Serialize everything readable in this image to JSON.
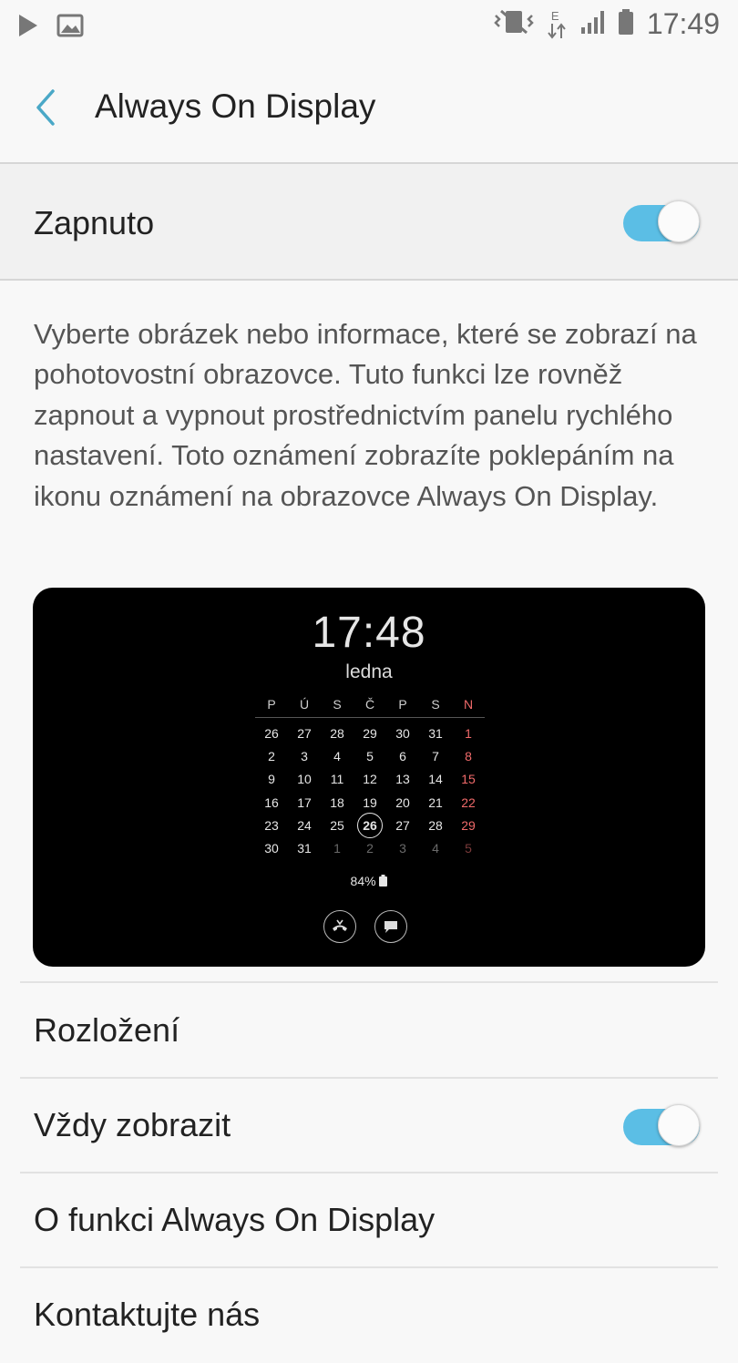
{
  "status_bar": {
    "time": "17:49",
    "network_type": "E",
    "icons": [
      "play-icon",
      "image-icon",
      "mute-vibrate-icon",
      "data-arrows-icon",
      "signal-icon",
      "battery-icon"
    ]
  },
  "header": {
    "title": "Always On Display"
  },
  "master": {
    "label": "Zapnuto",
    "enabled": true
  },
  "description": "Vyberte obrázek nebo informace, které se zobrazí na pohotovostní obrazovce. Tuto funkci lze rovněž zapnout a vypnout prostřednictvím panelu rychlého nastavení. Toto oznámení zobrazíte poklepáním na ikonu oznámení na obrazovce Always On Display.",
  "preview": {
    "time": "17:48",
    "month": "ledna",
    "weekdays": [
      "P",
      "Ú",
      "S",
      "Č",
      "P",
      "S",
      "N"
    ],
    "weeks": [
      [
        "26",
        "27",
        "28",
        "29",
        "30",
        "31",
        "1"
      ],
      [
        "2",
        "3",
        "4",
        "5",
        "6",
        "7",
        "8"
      ],
      [
        "9",
        "10",
        "11",
        "12",
        "13",
        "14",
        "15"
      ],
      [
        "16",
        "17",
        "18",
        "19",
        "20",
        "21",
        "22"
      ],
      [
        "23",
        "24",
        "25",
        "26",
        "27",
        "28",
        "29"
      ],
      [
        "30",
        "31",
        "1",
        "2",
        "3",
        "4",
        "5"
      ]
    ],
    "today": "26",
    "battery": "84%"
  },
  "menu": {
    "layout_label": "Rozložení",
    "always_show_label": "Vždy zobrazit",
    "always_show_enabled": true,
    "about_label": "O funkci Always On Display",
    "contact_label": "Kontaktujte nás"
  },
  "colors": {
    "accent": "#5bbee5",
    "back_arrow": "#4aa8c7",
    "sunday": "#f06a6a"
  }
}
